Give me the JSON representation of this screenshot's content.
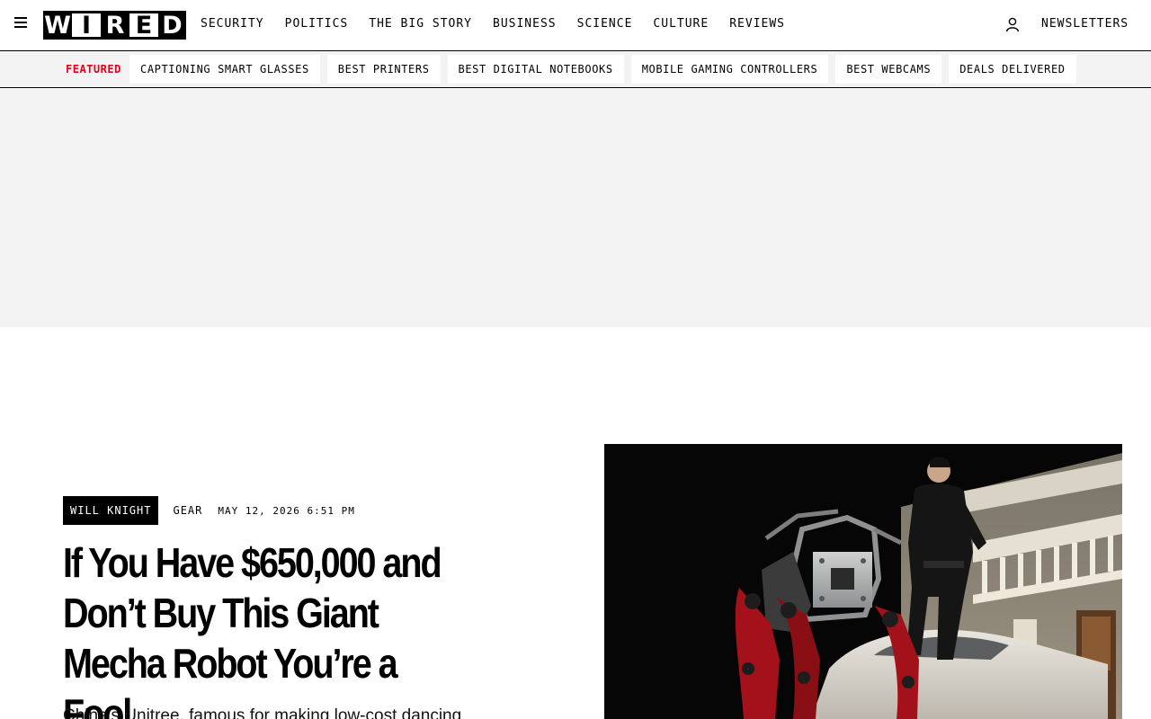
{
  "brand": {
    "logo_letters": [
      "W",
      "I",
      "R",
      "E",
      "D"
    ]
  },
  "nav": {
    "links": [
      "SECURITY",
      "POLITICS",
      "THE BIG STORY",
      "BUSINESS",
      "SCIENCE",
      "CULTURE",
      "REVIEWS"
    ],
    "newsletters": "NEWSLETTERS"
  },
  "featured": {
    "label": "FEATURED",
    "chips": [
      "CAPTIONING SMART GLASSES",
      "BEST PRINTERS",
      "BEST DIGITAL NOTEBOOKS",
      "MOBILE GAMING CONTROLLERS",
      "BEST WEBCAMS",
      "DEALS DELIVERED"
    ]
  },
  "article": {
    "author": "WILL KNIGHT",
    "category": "GEAR",
    "date": "MAY 12, 2026 6:51 PM",
    "headline": "If You Have $650,000 and Don’t Buy This Giant Mecha Robot You’re a Fool",
    "dek": "China’s Unitree, famous for making low-cost dancing"
  },
  "colors": {
    "featured_accent": "#e4001b",
    "ad_background": "#f3f3f3"
  },
  "icons": {
    "menu": "hamburger-icon",
    "account": "user-icon"
  }
}
